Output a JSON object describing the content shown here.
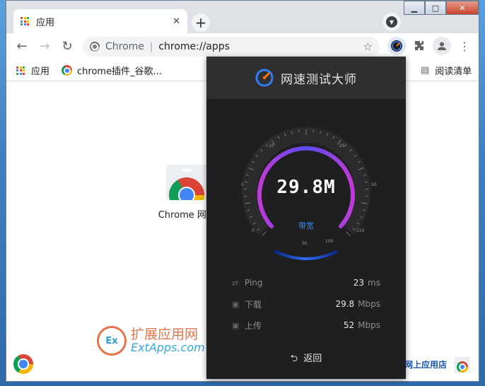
{
  "window": {
    "minimize": "▁",
    "maximize": "□",
    "close": "✕"
  },
  "tab": {
    "title": "应用",
    "close": "✕"
  },
  "toolbar": {
    "back": "←",
    "forward": "→",
    "reload": "↻",
    "site_label": "Chrome",
    "separator": "|",
    "url": "chrome://apps",
    "star": "☆"
  },
  "bookmarks": {
    "items": [
      {
        "label": "应用"
      },
      {
        "label": "chrome插件_谷歌..."
      }
    ],
    "reading_list": "阅读清单"
  },
  "apps": [
    {
      "label": "Chrome 网..."
    }
  ],
  "footer": {
    "store_link": "网上应用店"
  },
  "watermark": {
    "logo_text": "Ex",
    "cn": "扩展应用网",
    "en": "ExtApps.com"
  },
  "popup": {
    "title": "网速测试大师",
    "speed": "29.8M",
    "gauge_label": "带宽",
    "gauge_ticks": [
      "0",
      "5",
      "10",
      "25",
      "50",
      "100",
      "150"
    ],
    "gauge_bottom": "50",
    "stats": [
      {
        "icon": "⇄",
        "name": "Ping",
        "value": "23",
        "unit": "ms"
      },
      {
        "icon": "▣",
        "name": "下载",
        "value": "29.8",
        "unit": "Mbps"
      },
      {
        "icon": "▣",
        "name": "上传",
        "value": "52",
        "unit": "Mbps"
      }
    ],
    "back": "返回"
  },
  "colors": {
    "accent_blue": "#1a73e8",
    "gauge_purple": "#b23fe0",
    "gauge_blue": "#2f5cf0"
  }
}
